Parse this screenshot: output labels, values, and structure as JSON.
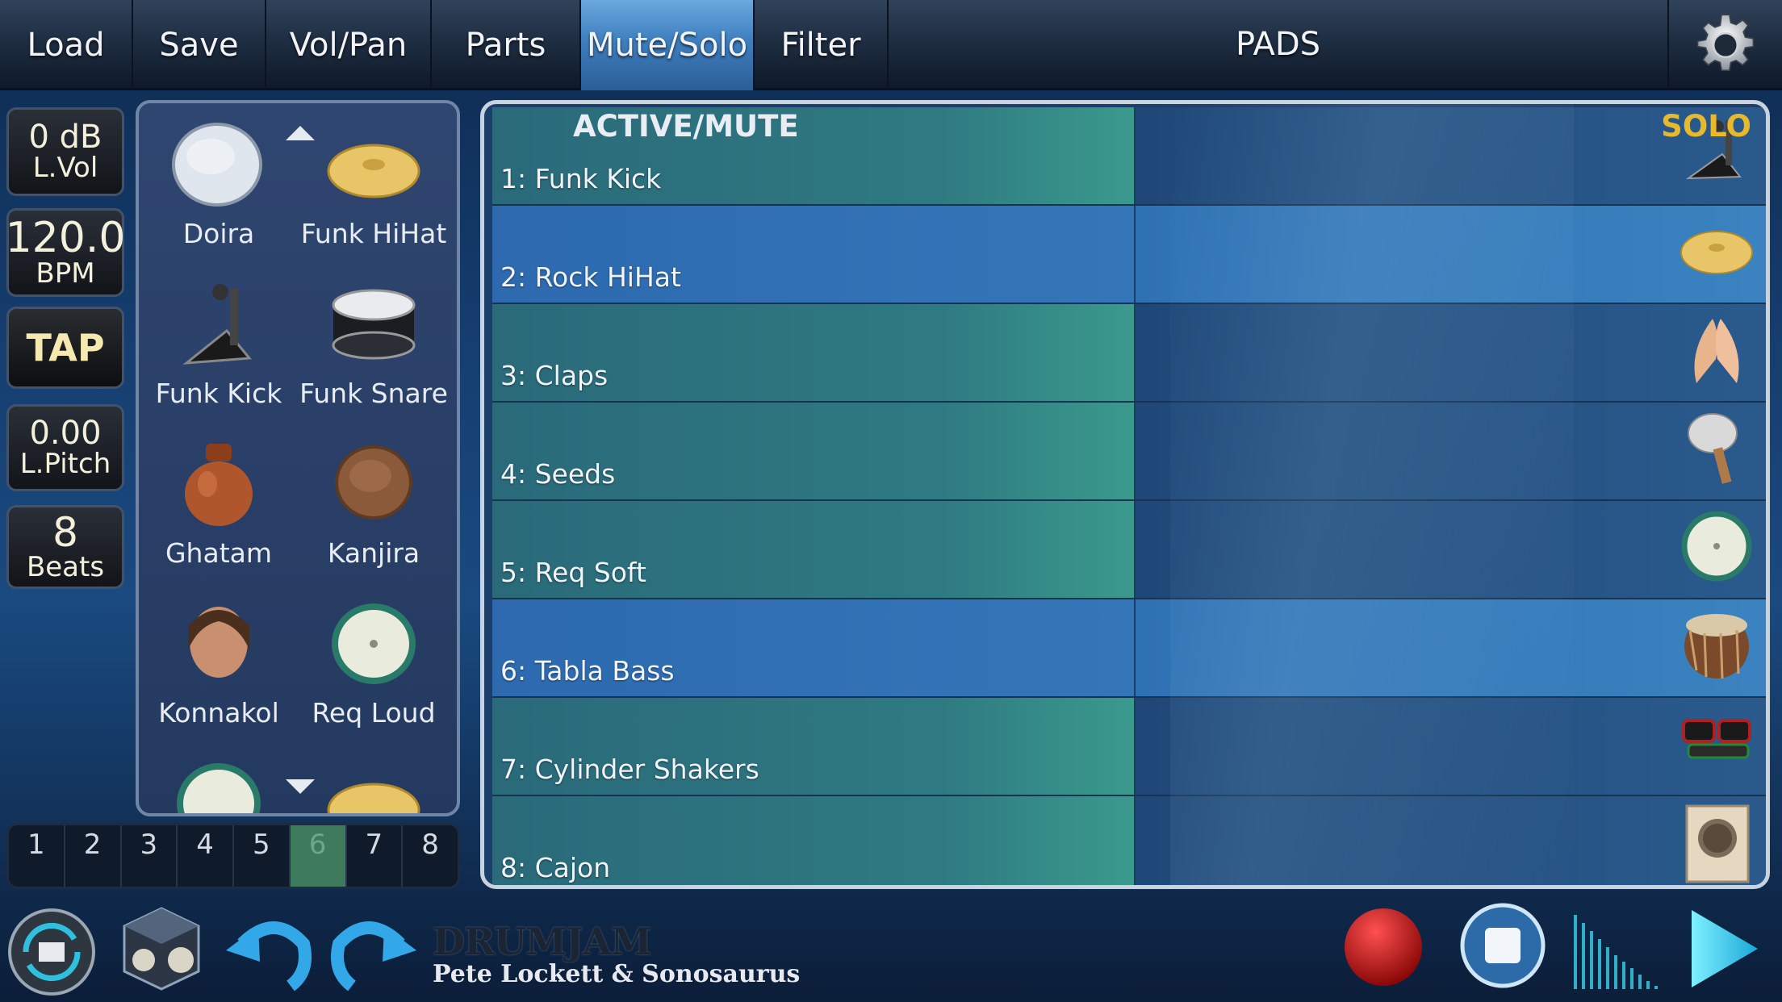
{
  "toolbar": {
    "tabs": [
      "Load",
      "Save",
      "Vol/Pan",
      "Parts",
      "Mute/Solo",
      "Filter"
    ],
    "active_tab": "Mute/Solo",
    "title": "PADS",
    "settings_icon": "gear-icon"
  },
  "left_panel": {
    "lvol_value": "0 dB",
    "lvol_label": "L.Vol",
    "bpm_value": "120.0",
    "bpm_label": "BPM",
    "tap_label": "TAP",
    "lpitch_value": "0.00",
    "lpitch_label": "L.Pitch",
    "beats_value": "8",
    "beats_label": "Beats"
  },
  "picker": {
    "instruments": [
      "Doira",
      "Funk HiHat",
      "Funk Kick",
      "Funk Snare",
      "Ghatam",
      "Kanjira",
      "Konnakol",
      "Req Loud"
    ]
  },
  "pages": {
    "items": [
      "1",
      "2",
      "3",
      "4",
      "5",
      "6",
      "7",
      "8"
    ],
    "selected": "6"
  },
  "grid": {
    "header_active": "ACTIVE/MUTE",
    "header_solo": "SOLO",
    "tracks": [
      {
        "label": "1: Funk Kick",
        "icon": "kick-pedal-icon",
        "state": "active"
      },
      {
        "label": "2: Rock HiHat",
        "icon": "cymbal-icon",
        "state": "muted"
      },
      {
        "label": "3: Claps",
        "icon": "clap-hands-icon",
        "state": "active"
      },
      {
        "label": "4: Seeds",
        "icon": "shaker-icon",
        "state": "active"
      },
      {
        "label": "5: Req Soft",
        "icon": "tambourine-icon",
        "state": "active"
      },
      {
        "label": "6: Tabla Bass",
        "icon": "tabla-icon",
        "state": "muted"
      },
      {
        "label": "7: Cylinder Shakers",
        "icon": "cylinder-shaker-icon",
        "state": "active"
      },
      {
        "label": "8: Cajon",
        "icon": "cajon-icon",
        "state": "active"
      }
    ]
  },
  "bottom": {
    "brand_title": "DRUMJAM",
    "brand_sub": "Pete Lockett & Sonosaurus",
    "colors": {
      "record": "#c81414",
      "accent": "#2fc0e0"
    }
  }
}
